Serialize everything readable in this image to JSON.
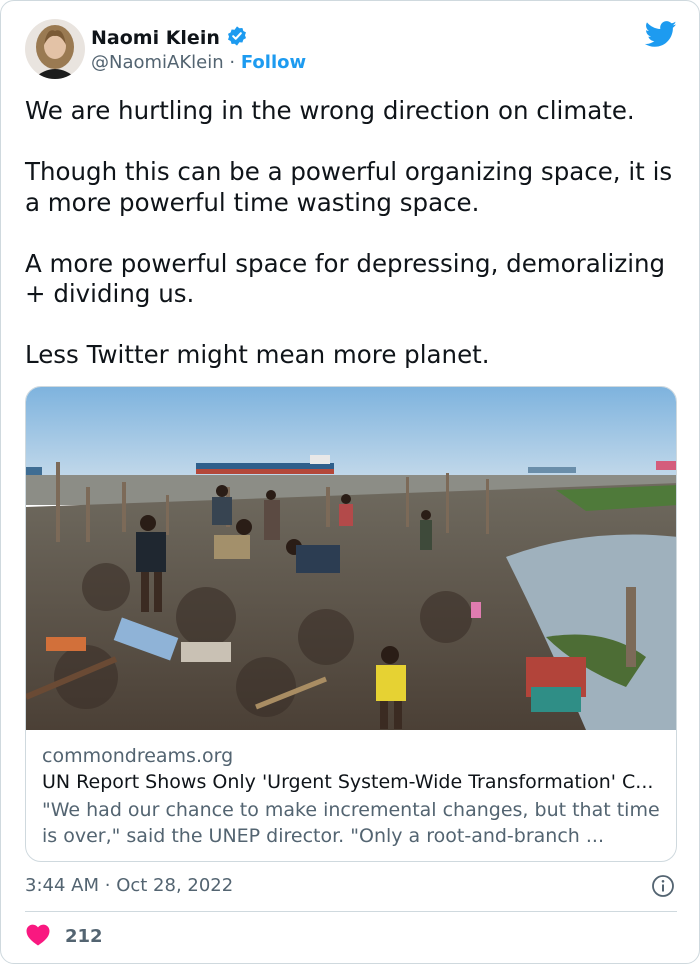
{
  "author": {
    "name": "Naomi Klein",
    "handle": "@NaomiAKlein",
    "separator": "·",
    "follow_label": "Follow",
    "verified": true
  },
  "tweet": {
    "paragraphs": [
      "We are hurtling in the wrong direction on climate.",
      "Though this can be a powerful organizing space, it is a more powerful time wasting space.",
      "A more powerful space for depressing, demoralizing + dividing us.",
      "Less Twitter might mean more planet."
    ]
  },
  "link_card": {
    "domain": "commondreams.org",
    "title": "UN Report Shows Only 'Urgent System-Wide Transformation' C...",
    "description": "\"We had our chance to make incremental changes, but that time is over,\" said the UNEP director. \"Only a root-and-branch ..."
  },
  "meta": {
    "time": "3:44 AM",
    "separator": "·",
    "date": "Oct 28, 2022"
  },
  "engagement": {
    "likes": "212"
  },
  "colors": {
    "accent": "#1d9bf0",
    "like": "#f91880",
    "secondary_text": "#536471"
  },
  "icons": {
    "brand": "twitter-bird-icon",
    "verified": "verified-badge-icon",
    "info": "info-icon",
    "like": "heart-icon"
  }
}
